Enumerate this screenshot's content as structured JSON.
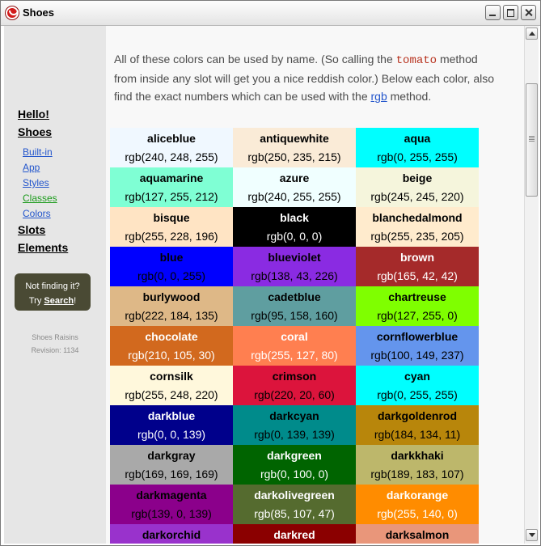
{
  "window": {
    "title": "Shoes"
  },
  "sidebar": {
    "main_links": [
      "Hello!",
      "Shoes",
      "Slots",
      "Elements"
    ],
    "sub_links": [
      "Built-in",
      "App",
      "Styles",
      "Classes",
      "Colors"
    ],
    "active_sub": "Classes",
    "help": {
      "line1": "Not finding it?",
      "try_label": "Try",
      "search_label": "Search",
      "suffix": "!"
    },
    "revision": {
      "name": "Shoes Raisins",
      "revision": "Revision: 1134"
    }
  },
  "intro": {
    "t1": "All of these colors can be used by name.  (So calling the ",
    "code": "tomato",
    "t2": " method from inside any slot will get you a nice reddish color.)  Below each color, also find the exact numbers which can be used with the ",
    "link": "rgb",
    "t3": " method."
  },
  "colors": [
    {
      "name": "aliceblue",
      "rgb": "rgb(240, 248, 255)",
      "bg": "#f0f8ff",
      "fg": "#000000"
    },
    {
      "name": "antiquewhite",
      "rgb": "rgb(250, 235, 215)",
      "bg": "#faebd7",
      "fg": "#000000"
    },
    {
      "name": "aqua",
      "rgb": "rgb(0, 255, 255)",
      "bg": "#00ffff",
      "fg": "#000000"
    },
    {
      "name": "aquamarine",
      "rgb": "rgb(127, 255, 212)",
      "bg": "#7fffd4",
      "fg": "#000000"
    },
    {
      "name": "azure",
      "rgb": "rgb(240, 255, 255)",
      "bg": "#f0ffff",
      "fg": "#000000"
    },
    {
      "name": "beige",
      "rgb": "rgb(245, 245, 220)",
      "bg": "#f5f5dc",
      "fg": "#000000"
    },
    {
      "name": "bisque",
      "rgb": "rgb(255, 228, 196)",
      "bg": "#ffe4c4",
      "fg": "#000000"
    },
    {
      "name": "black",
      "rgb": "rgb(0, 0, 0)",
      "bg": "#000000",
      "fg": "#ffffff"
    },
    {
      "name": "blanchedalmond",
      "rgb": "rgb(255, 235, 205)",
      "bg": "#ffebcd",
      "fg": "#000000"
    },
    {
      "name": "blue",
      "rgb": "rgb(0, 0, 255)",
      "bg": "#0000ff",
      "fg": "#000000"
    },
    {
      "name": "blueviolet",
      "rgb": "rgb(138, 43, 226)",
      "bg": "#8a2be2",
      "fg": "#000000"
    },
    {
      "name": "brown",
      "rgb": "rgb(165, 42, 42)",
      "bg": "#a52a2a",
      "fg": "#ffffff"
    },
    {
      "name": "burlywood",
      "rgb": "rgb(222, 184, 135)",
      "bg": "#deb887",
      "fg": "#000000"
    },
    {
      "name": "cadetblue",
      "rgb": "rgb(95, 158, 160)",
      "bg": "#5f9ea0",
      "fg": "#000000"
    },
    {
      "name": "chartreuse",
      "rgb": "rgb(127, 255, 0)",
      "bg": "#7fff00",
      "fg": "#000000"
    },
    {
      "name": "chocolate",
      "rgb": "rgb(210, 105, 30)",
      "bg": "#d2691e",
      "fg": "#ffffff"
    },
    {
      "name": "coral",
      "rgb": "rgb(255, 127, 80)",
      "bg": "#ff7f50",
      "fg": "#ffffff"
    },
    {
      "name": "cornflowerblue",
      "rgb": "rgb(100, 149, 237)",
      "bg": "#6495ed",
      "fg": "#000000"
    },
    {
      "name": "cornsilk",
      "rgb": "rgb(255, 248, 220)",
      "bg": "#fff8dc",
      "fg": "#000000"
    },
    {
      "name": "crimson",
      "rgb": "rgb(220, 20, 60)",
      "bg": "#dc143c",
      "fg": "#000000"
    },
    {
      "name": "cyan",
      "rgb": "rgb(0, 255, 255)",
      "bg": "#00ffff",
      "fg": "#000000"
    },
    {
      "name": "darkblue",
      "rgb": "rgb(0, 0, 139)",
      "bg": "#00008b",
      "fg": "#ffffff"
    },
    {
      "name": "darkcyan",
      "rgb": "rgb(0, 139, 139)",
      "bg": "#008b8b",
      "fg": "#000000"
    },
    {
      "name": "darkgoldenrod",
      "rgb": "rgb(184, 134, 11)",
      "bg": "#b8860b",
      "fg": "#000000"
    },
    {
      "name": "darkgray",
      "rgb": "rgb(169, 169, 169)",
      "bg": "#a9a9a9",
      "fg": "#000000"
    },
    {
      "name": "darkgreen",
      "rgb": "rgb(0, 100, 0)",
      "bg": "#006400",
      "fg": "#ffffff"
    },
    {
      "name": "darkkhaki",
      "rgb": "rgb(189, 183, 107)",
      "bg": "#bdb76b",
      "fg": "#000000"
    },
    {
      "name": "darkmagenta",
      "rgb": "rgb(139, 0, 139)",
      "bg": "#8b008b",
      "fg": "#000000"
    },
    {
      "name": "darkolivegreen",
      "rgb": "rgb(85, 107, 47)",
      "bg": "#556b2f",
      "fg": "#ffffff"
    },
    {
      "name": "darkorange",
      "rgb": "rgb(255, 140, 0)",
      "bg": "#ff8c00",
      "fg": "#ffffff"
    },
    {
      "name": "darkorchid",
      "rgb": "",
      "bg": "#9932cc",
      "fg": "#000000"
    },
    {
      "name": "darkred",
      "rgb": "",
      "bg": "#8b0000",
      "fg": "#ffffff"
    },
    {
      "name": "darksalmon",
      "rgb": "",
      "bg": "#e9967a",
      "fg": "#000000"
    }
  ]
}
